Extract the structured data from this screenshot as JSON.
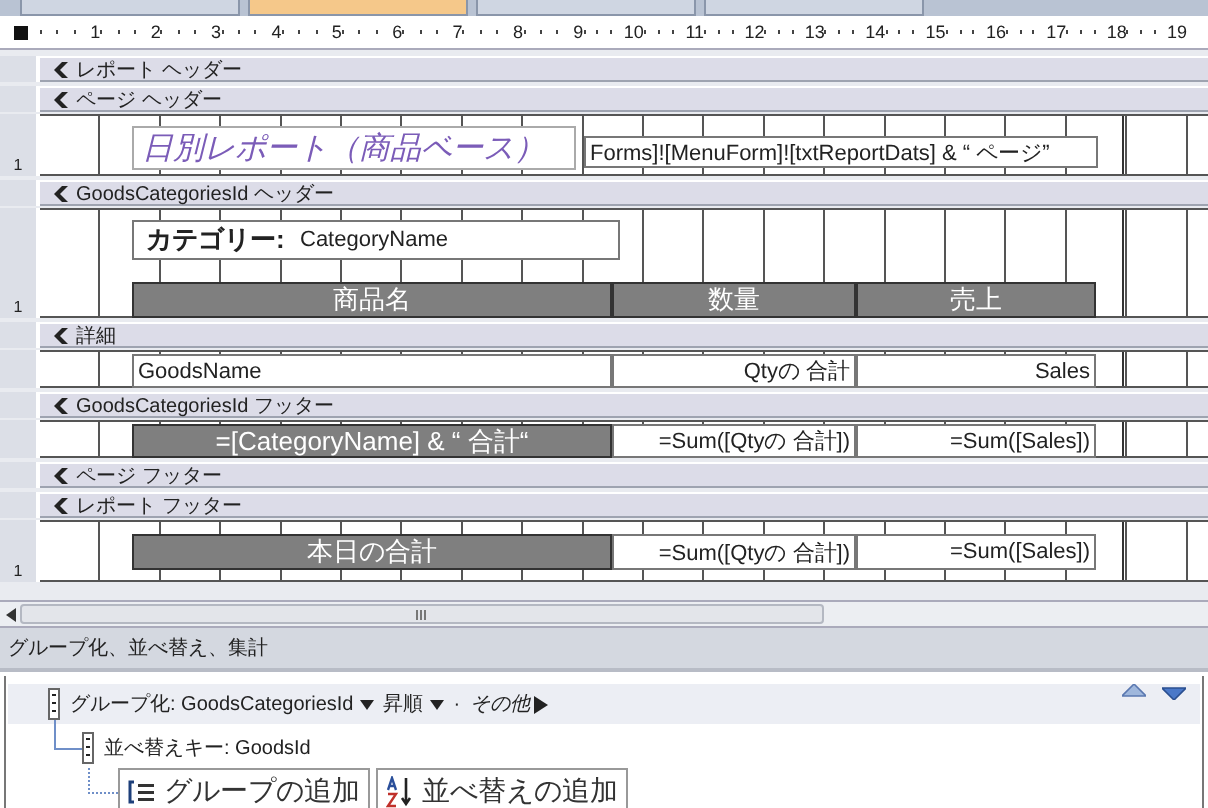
{
  "tabs": [
    {
      "selected": false
    },
    {
      "selected": true
    },
    {
      "selected": false
    },
    {
      "selected": false
    }
  ],
  "ruler": {
    "marks": [
      "1",
      "2",
      "3",
      "4",
      "5",
      "6",
      "7",
      "8",
      "9",
      "10",
      "11",
      "12",
      "13",
      "14",
      "15",
      "16",
      "17",
      "18",
      "19"
    ]
  },
  "sections": [
    {
      "title": "レポート ヘッダー"
    },
    {
      "title": "ページ ヘッダー",
      "body": {
        "kind": "title",
        "ruler_label": "1",
        "title": "日別レポート（商品ベース）",
        "expression": "Forms]![MenuForm]![txtReportDats] & “ ページ”"
      }
    },
    {
      "title": "GoodsCategoriesId ヘッダー",
      "body": {
        "kind": "group_header",
        "ruler_label": "1",
        "label": "カテゴリー:",
        "field": "CategoryName",
        "columns": [
          "商品名",
          "数量",
          "売上"
        ]
      }
    },
    {
      "title": "詳細",
      "body": {
        "kind": "row",
        "cells": [
          {
            "kind": "field",
            "text": "GoodsName"
          },
          {
            "kind": "field",
            "text": "Qtyの 合計"
          },
          {
            "kind": "field",
            "text": "Sales"
          }
        ]
      }
    },
    {
      "title": "GoodsCategoriesId フッター",
      "body": {
        "kind": "row",
        "cells": [
          {
            "kind": "heading",
            "text": "=[CategoryName] & “ 合計“"
          },
          {
            "kind": "field",
            "text": "=Sum([Qtyの 合計])"
          },
          {
            "kind": "field",
            "text": "=Sum([Sales])"
          }
        ]
      }
    },
    {
      "title": "ページ フッター"
    },
    {
      "title": "レポート フッター",
      "body": {
        "kind": "total",
        "ruler_label": "1",
        "cells": [
          {
            "kind": "heading",
            "text": "本日の合計"
          },
          {
            "kind": "field",
            "text": "=Sum([Qtyの 合計])"
          },
          {
            "kind": "field",
            "text": "=Sum([Sales])"
          }
        ]
      }
    }
  ],
  "grouping_pane": {
    "title": "グループ化、並べ替え、集計",
    "group": {
      "label": "グループ化: GoodsCategoriesId",
      "order": "昇順",
      "separator": "·",
      "more": "その他"
    },
    "sort": {
      "label": "並べ替えキー: GoodsId"
    },
    "buttons": [
      {
        "kind": "group",
        "label": "グループの追加"
      },
      {
        "kind": "sort",
        "label": "並べ替えの追加"
      }
    ]
  }
}
